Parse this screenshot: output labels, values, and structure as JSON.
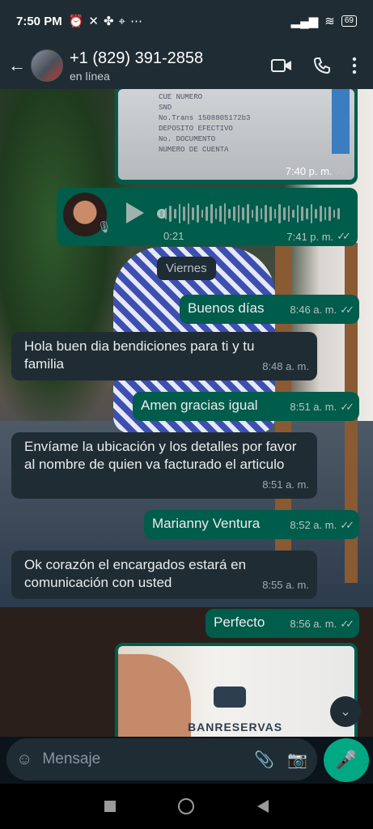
{
  "status_bar": {
    "time": "7:50 PM",
    "battery": "69"
  },
  "header": {
    "phone": "+1 (829) 391-2858",
    "status": "en línea"
  },
  "receipt_image": {
    "lines": [
      "CUE NUMERO",
      "SND",
      "No.Trans 1508805172b3",
      "DEPOSITO EFECTIVO",
      "No. DOCUMENTO",
      "NUMERO DE CUENTA"
    ],
    "time": "7:40 p. m."
  },
  "voice_note": {
    "duration": "0:21",
    "time": "7:41 p. m."
  },
  "day_separator": "Viernes",
  "messages": [
    {
      "text": "Buenos días",
      "time": "8:46 a. m.",
      "dir": "out"
    },
    {
      "text": "Hola buen dia bendiciones para ti y tu familia",
      "time": "8:48 a. m.",
      "dir": "in"
    },
    {
      "text": "Amen gracias igual",
      "time": "8:51 a. m.",
      "dir": "out"
    },
    {
      "text": "Envíame la ubicación y los detalles por favor al nombre de quien va facturado el articulo",
      "time": "8:51 a. m.",
      "dir": "in"
    },
    {
      "text": "Marianny Ventura",
      "time": "8:52 a. m.",
      "dir": "out"
    },
    {
      "text": "Ok corazón el encargados estará en comunicación con usted",
      "time": "8:55 a. m.",
      "dir": "in"
    },
    {
      "text": "Perfecto",
      "time": "8:56 a. m.",
      "dir": "out"
    }
  ],
  "bottom_image": {
    "brand_text": "BANRESERVAS"
  },
  "composer": {
    "placeholder": "Mensaje"
  }
}
